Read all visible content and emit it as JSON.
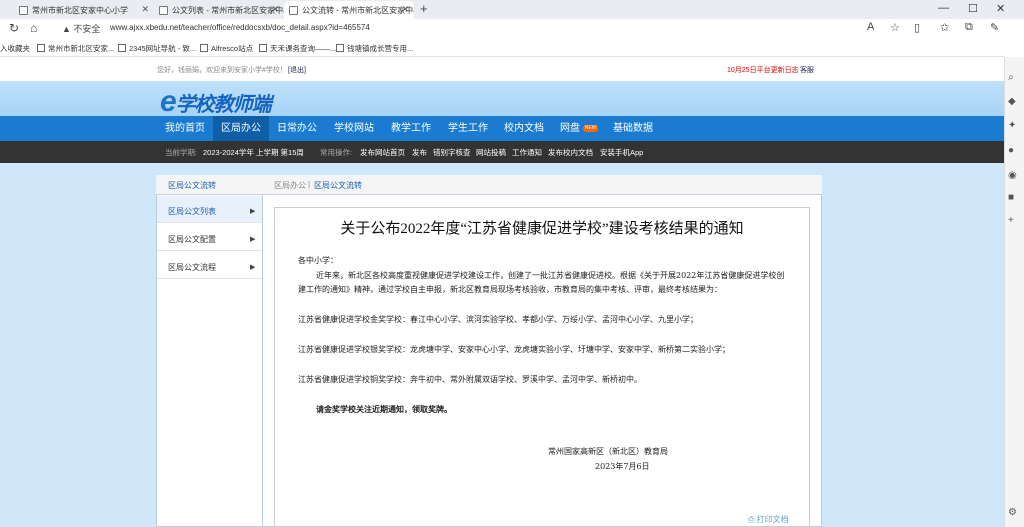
{
  "browser": {
    "tabs": [
      "常州市新北区安家中心小学",
      "公文列表 - 常州市新北区安家中心",
      "公文流转 - 常州市新北区安家中心"
    ],
    "security": "不安全",
    "url": "www.ajxx.xbedu.net/teacher/office/reddocsxb/doc_detail.aspx?id=465574",
    "bookmarks": [
      "入收藏夹",
      "常州市新北区安家...",
      "2345网址导航 - 致...",
      "Alfresco站点",
      "天禾课务查询——...",
      "钱塘镇成长营专用..."
    ]
  },
  "header": {
    "welcome": "您好，钱丽娟，欢迎来到安家小学#学校！",
    "logout": "[退出]",
    "update": "10月25日平台更新日志",
    "feedback": "客服",
    "logo_e": "e",
    "logo_text": "学校教师端"
  },
  "nav": {
    "items": [
      "我的首页",
      "区局办公",
      "日常办公",
      "学校网站",
      "教学工作",
      "学生工作",
      "校内文档",
      "网盘",
      "基础数据"
    ],
    "new_badge": "NEW"
  },
  "subbar": {
    "term_label": "当前学期:",
    "term": "2023-2024学年 上学期 第15周",
    "ops_label": "常用操作:",
    "ops": [
      "发布网站首页",
      "发布",
      "错别字核查",
      "网站投稿",
      "工作通知",
      "发布校内文档",
      "安装手机App"
    ]
  },
  "sidebar": {
    "title": "区局公文流转",
    "items": [
      "区局公文列表",
      "区局公文配置",
      "区局公文流程"
    ]
  },
  "breadcrumb": {
    "root": "区局办公",
    "sep": "|",
    "current": "区局公文流转"
  },
  "doc": {
    "title": "关于公布2022年度“江苏省健康促进学校”建设考核结果的通知",
    "salutation": "各中小学：",
    "body1": "近年来，新北区各校高度重视健康促进学校建设工作，创建了一批江苏省健康促进校。根据《关于开展2022年江苏省健康促进学校创建工作的通知》精神，通过学校自主申报，新北区教育局现场考核验收，市教育局的集中考核、评审，最终考核结果为：",
    "gold": "江苏省健康促进学校金奖学校：春江中心小学、滨河实验学校、孝都小学、万绥小学、孟河中心小学、九里小学；",
    "silver": "江苏省健康促进学校银奖学校：龙虎塘中学、安家中心小学、龙虎塘实验小学、圩塘中学、安家中学、新桥第二实验小学；",
    "bronze": "江苏省健康促进学校铜奖学校：奔牛初中、常外附属双语学校、罗溪中学、孟河中学、新桥初中。",
    "notice": "请金奖学校关注近期通知，领取奖牌。",
    "sign_org": "常州国家高新区（新北区）教育局",
    "sign_date": "2023年7月6日",
    "print": "打印文档"
  }
}
